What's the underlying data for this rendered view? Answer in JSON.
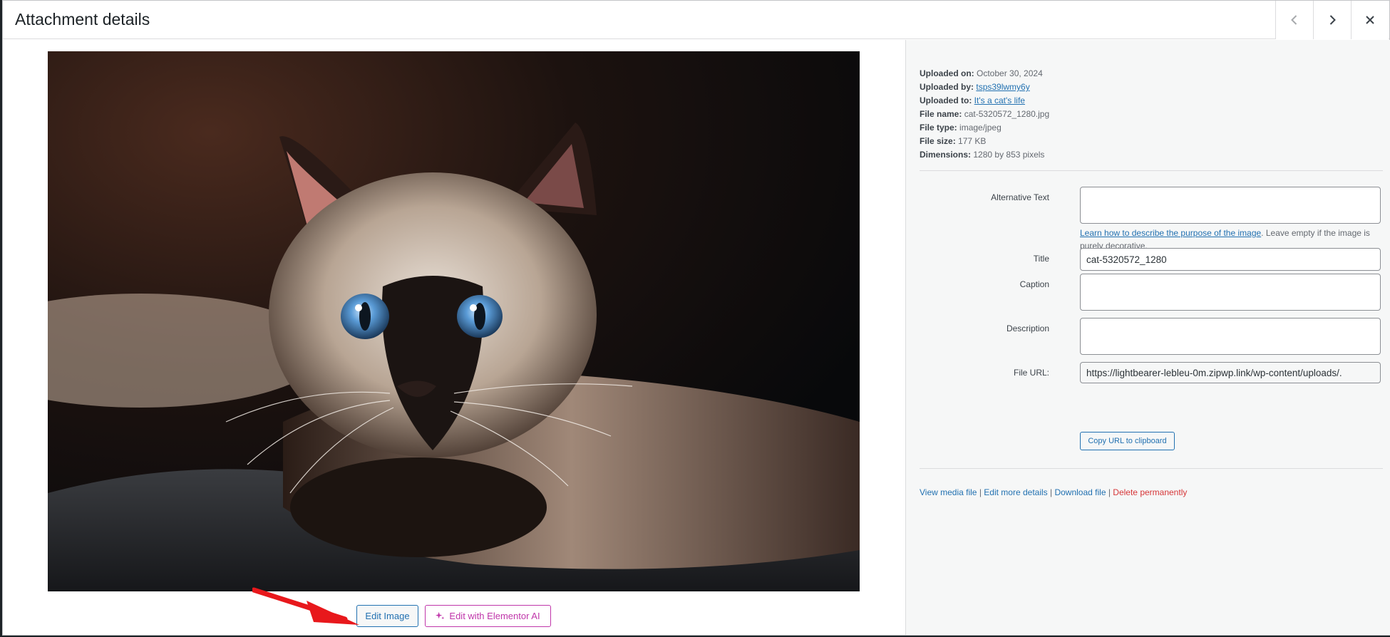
{
  "header": {
    "title": "Attachment details",
    "prev_icon": "chevron-left-icon",
    "next_icon": "chevron-right-icon",
    "close_icon": "close-icon"
  },
  "media": {
    "image_alt": "Siamese cat with blue eyes",
    "edit_image_label": "Edit Image",
    "edit_ai_label": "Edit with Elementor AI",
    "ai_icon": "sparkle-icon"
  },
  "details": {
    "uploaded_on_label": "Uploaded on:",
    "uploaded_on": "October 30, 2024",
    "uploaded_by_label": "Uploaded by:",
    "uploaded_by": "tsps39lwmy6y",
    "uploaded_to_label": "Uploaded to:",
    "uploaded_to": "It's a cat's life",
    "file_name_label": "File name:",
    "file_name": "cat-5320572_1280.jpg",
    "file_type_label": "File type:",
    "file_type": "image/jpeg",
    "file_size_label": "File size:",
    "file_size": "177 KB",
    "dimensions_label": "Dimensions:",
    "dimensions": "1280 by 853 pixels"
  },
  "form": {
    "alt_label": "Alternative Text",
    "alt_value": "",
    "alt_hint_link": "Learn how to describe the purpose of the image",
    "alt_hint_rest": ". Leave empty if the image is purely decorative.",
    "title_label": "Title",
    "title_value": "cat-5320572_1280",
    "caption_label": "Caption",
    "caption_value": "",
    "description_label": "Description",
    "description_value": "",
    "url_label": "File URL:",
    "url_value": "https://lightbearer-lebleu-0m.zipwp.link/wp-content/uploads/.",
    "copy_label": "Copy URL to clipboard"
  },
  "links": {
    "view": "View media file",
    "edit_more": "Edit more details",
    "download": "Download file",
    "delete": "Delete permanently",
    "separator": " | "
  },
  "colors": {
    "link": "#2271b1",
    "delete": "#d63638",
    "elementor": "#c036aa",
    "arrow": "#e8181c"
  }
}
